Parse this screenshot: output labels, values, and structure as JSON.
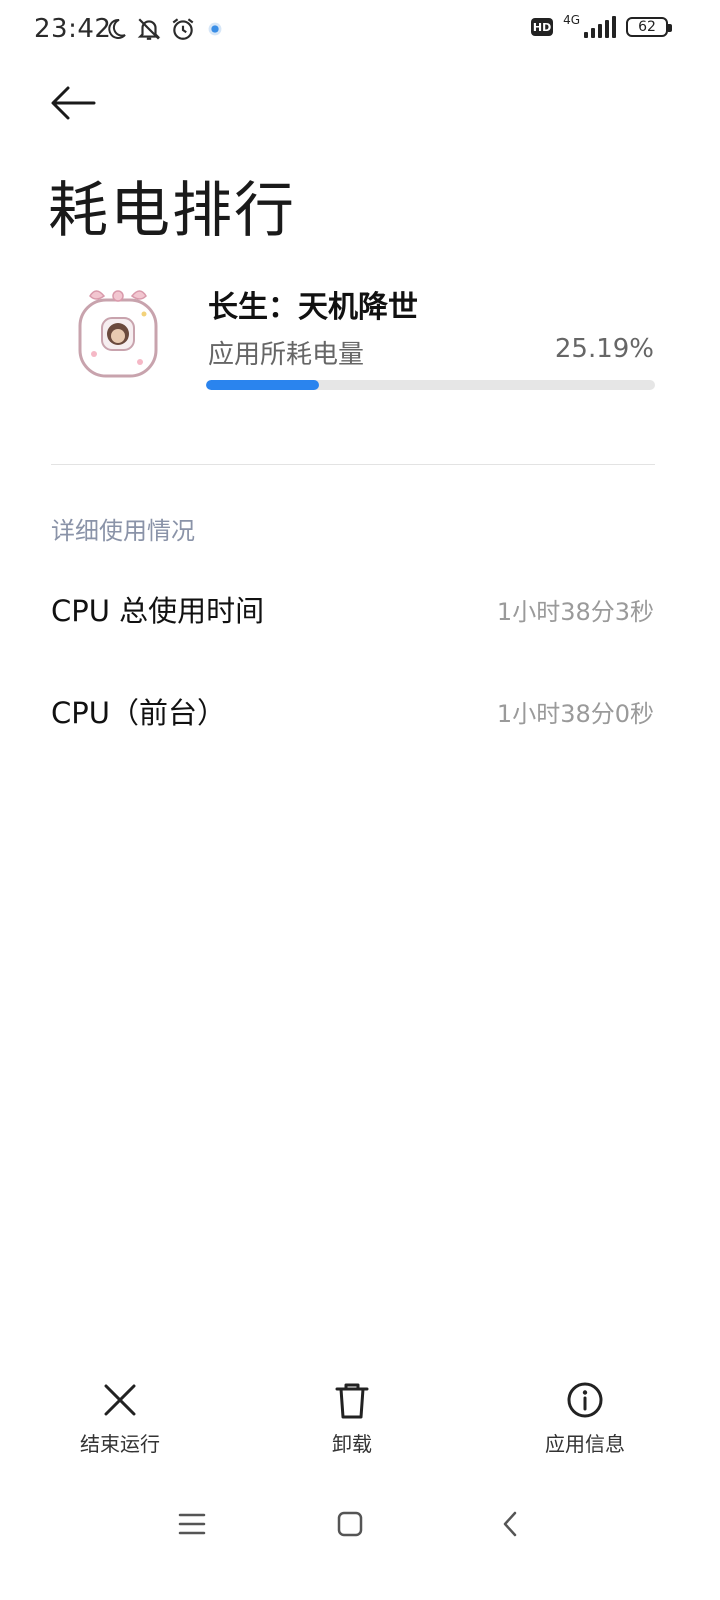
{
  "status_bar": {
    "time": "23:42",
    "hd_badge": "HD",
    "network_label": "4G",
    "battery_level": "62",
    "icons": [
      "moon-icon",
      "bell-off-icon",
      "alarm-icon",
      "dot-icon",
      "signal-icon",
      "battery-icon"
    ]
  },
  "header": {
    "title": "耗电排行"
  },
  "app": {
    "name": "长生：天机降世",
    "usage_label": "应用所耗电量",
    "usage_percent_text": "25.19%",
    "usage_percent": 25.19,
    "accent_color": "#2a84ee"
  },
  "details": {
    "section_title": "详细使用情况",
    "rows": [
      {
        "label": "CPU 总使用时间",
        "value": "1小时38分3秒"
      },
      {
        "label": "CPU（前台）",
        "value": "1小时38分0秒"
      }
    ]
  },
  "actions": [
    {
      "label": "结束运行",
      "icon": "close-icon"
    },
    {
      "label": "卸载",
      "icon": "trash-icon"
    },
    {
      "label": "应用信息",
      "icon": "info-icon"
    }
  ],
  "nav": {
    "icons": [
      "menu-icon",
      "home-icon",
      "back-icon"
    ]
  }
}
